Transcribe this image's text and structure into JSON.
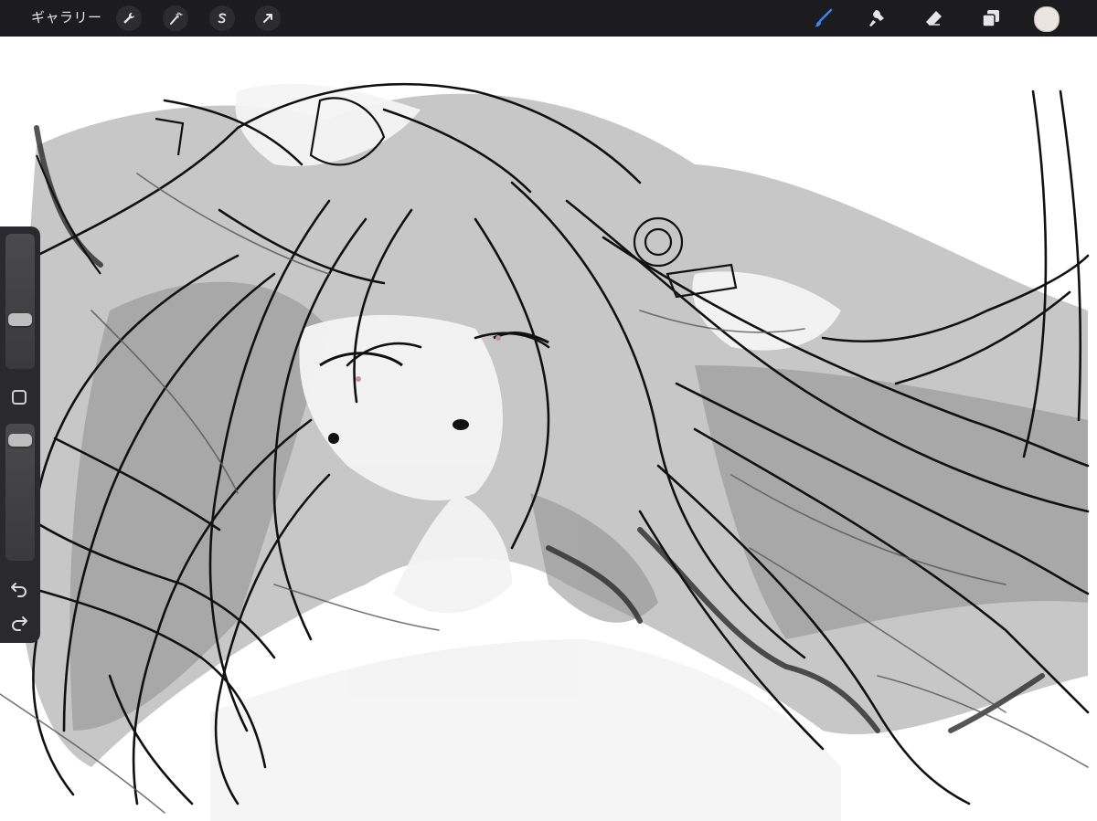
{
  "toolbar": {
    "gallery_label": "ギャラリー",
    "left_tools": [
      {
        "icon": "wrench-icon"
      },
      {
        "icon": "magic-wand-icon"
      },
      {
        "icon": "selection-s-icon"
      },
      {
        "icon": "transform-arrow-icon"
      }
    ],
    "right_tools": [
      {
        "icon": "brush-icon",
        "active": true
      },
      {
        "icon": "smudge-icon"
      },
      {
        "icon": "eraser-icon"
      },
      {
        "icon": "layers-icon"
      }
    ],
    "current_color": "#ece4df",
    "active_color": "#3b82f6"
  },
  "sidebar": {
    "brush_size_level": 0.35,
    "opacity_level": 0.92,
    "undo_icon": "undo-icon",
    "redo_icon": "redo-icon"
  },
  "canvas": {
    "artwork": "grayscale-line-sketch"
  }
}
